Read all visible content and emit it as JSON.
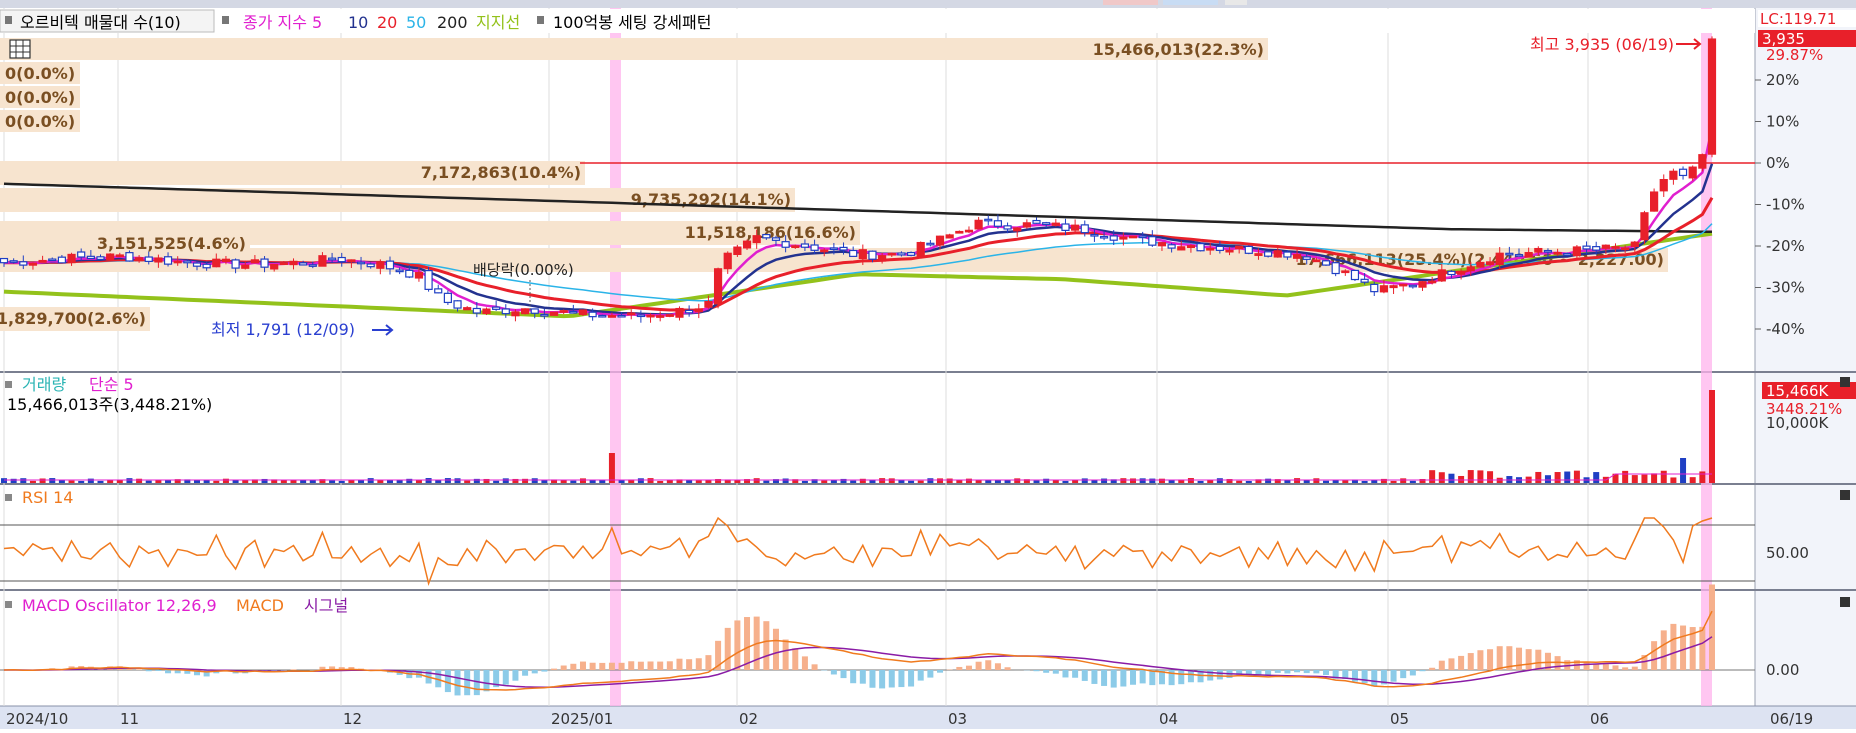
{
  "chart_data": {
    "type": "candlestick",
    "legend": {
      "stock": "오르비텍 매물대 수(10)",
      "ma_label": "종가 지수 5",
      "ma_periods": [
        "10",
        "20",
        "50",
        "200"
      ],
      "support_line": "지지선",
      "pattern": "100억봉 세팅 강세패턴"
    },
    "price_axis": {
      "ticks": [
        "20%",
        "10%",
        "0%",
        "-10%",
        "-20%",
        "-30%",
        "-40%"
      ],
      "lc_label": "LC:119.71",
      "last_price": "3,935",
      "last_change": "29.87%"
    },
    "volume_profile": [
      {
        "label": "15,466,013(22.3%)"
      },
      {
        "label": "0(0.0%)"
      },
      {
        "label": "0(0.0%)"
      },
      {
        "label": "0(0.0%)"
      },
      {
        "label": "7,172,863(10.4%)"
      },
      {
        "label": "9,735,292(14.1%)"
      },
      {
        "label": "11,518,186(16.6%)"
      },
      {
        "label": "3,151,525(4.6%)"
      },
      {
        "label": "1,829,700(2.6%)"
      },
      {
        "label": "17,666,113(25.4%)(2,440.50 ~ 2,227.00)"
      }
    ],
    "annotations": {
      "high": "최고 3,935 (06/19)",
      "low": "최저 1,791 (12/09)",
      "dividend": "배당락(0.00%)"
    },
    "volume_panel": {
      "title": "거래량",
      "ma": "단순 5",
      "value_text": "15,466,013주(3,448.21%)",
      "last_value": "15,466K",
      "last_pct": "3448.21%",
      "tick": "10,000K"
    },
    "rsi_panel": {
      "title": "RSI 14",
      "tick": "50.00"
    },
    "macd_panel": {
      "title": "MACD Oscillator 12,26,9",
      "macd": "MACD",
      "signal": "시그널",
      "tick": "0.00"
    },
    "x_axis": {
      "ticks": [
        "2024/10",
        "11",
        "12",
        "2025/01",
        "02",
        "03",
        "04",
        "05",
        "06"
      ],
      "last_date": "06/19"
    },
    "colors": {
      "up": "#e8202a",
      "down": "#1f3fc4",
      "ma5": "#e01fcf",
      "ma10": "#23328f",
      "ma20": "#e8202a",
      "ma50": "#2bb4e8",
      "ma200": "#222222",
      "support": "#93c21b",
      "highlight": "#ffb3ec",
      "profile": "#f7e4cf",
      "rsi": "#f07a1e",
      "macd": "#f07a1e",
      "signal": "#8a1ca6",
      "osc_pos": "#f6b08c",
      "osc_neg": "#8ccbe8"
    }
  }
}
